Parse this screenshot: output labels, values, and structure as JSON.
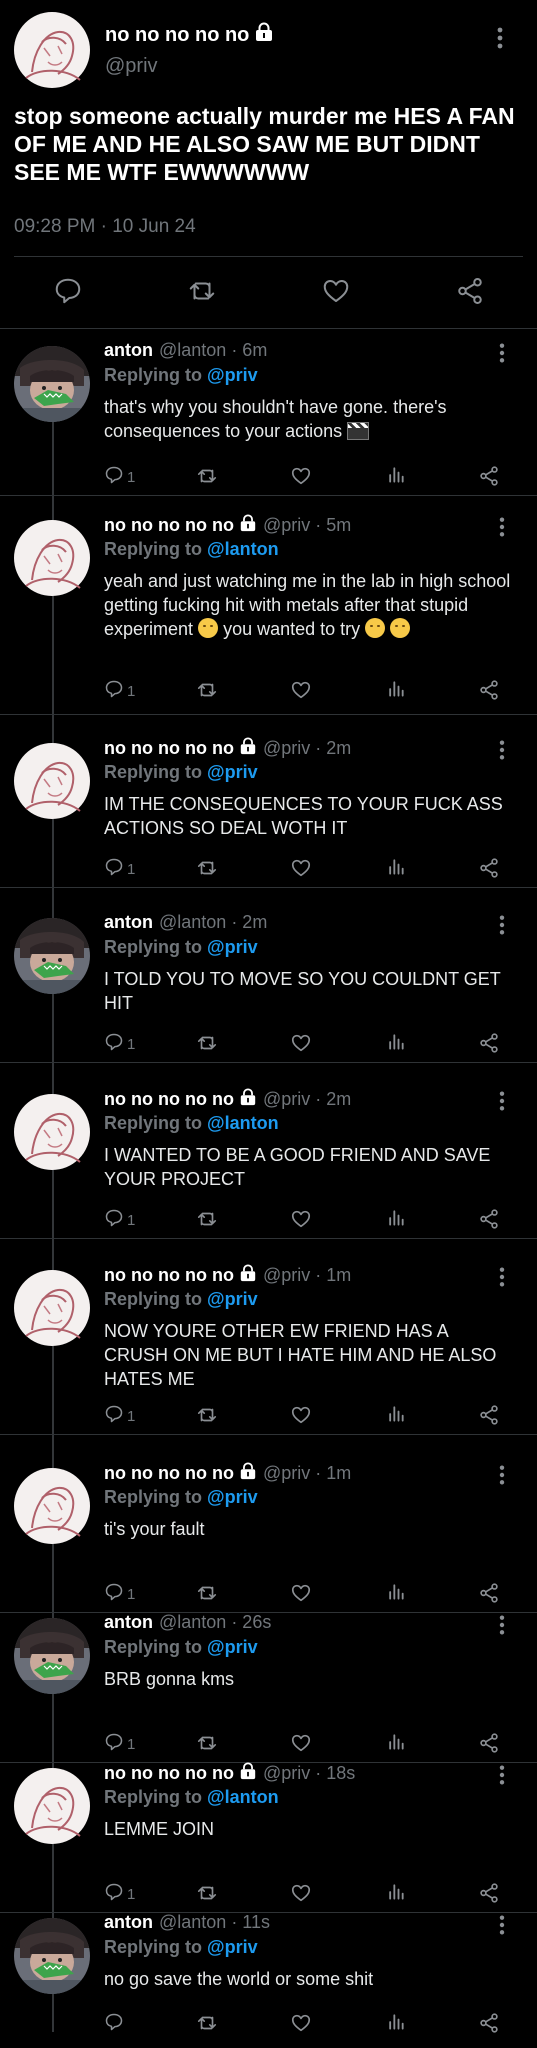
{
  "colors": {
    "background": "#000000",
    "text": "#e7e9ea",
    "muted": "#71767b",
    "link": "#1d9bf0",
    "divider": "#2f3336"
  },
  "main_tweet": {
    "display_name": "no no no no no",
    "handle": "@priv",
    "text": "stop someone actually murder me HES A FAN OF ME AND HE ALSO SAW ME BUT DIDNT SEE ME WTF EWWWWWW",
    "timestamp": "09:28 PM · 10 Jun 24",
    "icons": [
      "lock-icon",
      "more-icon",
      "comment-icon",
      "retweet-icon",
      "like-icon",
      "share-icon"
    ]
  },
  "replies": [
    {
      "avatar": "anton",
      "name": "anton",
      "meta": "@lanton · 6m",
      "replying_label": "Replying to",
      "mention": "@priv",
      "text": "that's why you shouldn't have gone. there's consequences to your actions",
      "comment_count": "1"
    },
    {
      "avatar": "priv",
      "name": "no no no no no",
      "meta": "@priv · 5m",
      "replying_label": "Replying to",
      "mention": "@lanton",
      "text": "yeah and just watching me in the lab in high school getting fucking hit with metals after that stupid experiment",
      "text_after": "you wanted to try",
      "comment_count": "1"
    },
    {
      "avatar": "priv",
      "name": "no no no no no",
      "meta": "@priv · 2m",
      "replying_label": "Replying to",
      "mention": "@priv",
      "text": "IM THE CONSEQUENCES TO YOUR FUCK ASS ACTIONS SO DEAL WOTH IT",
      "comment_count": "1"
    },
    {
      "avatar": "anton",
      "name": "anton",
      "meta": "@lanton · 2m",
      "replying_label": "Replying to",
      "mention": "@priv",
      "text": "I TOLD YOU TO MOVE SO YOU COULDNT GET HIT",
      "comment_count": "1"
    },
    {
      "avatar": "priv",
      "name": "no no no no no",
      "meta": "@priv · 2m",
      "replying_label": "Replying to",
      "mention": "@lanton",
      "text": "I WANTED TO BE A GOOD FRIEND AND SAVE YOUR PROJECT",
      "comment_count": "1"
    },
    {
      "avatar": "priv",
      "name": "no no no no no",
      "meta": "@priv · 1m",
      "replying_label": "Replying to",
      "mention": "@priv",
      "text": "NOW YOURE OTHER EW FRIEND HAS A CRUSH ON ME BUT I HATE HIM AND HE ALSO HATES ME",
      "comment_count": "1"
    },
    {
      "avatar": "priv",
      "name": "no no no no no",
      "meta": "@priv · 1m",
      "replying_label": "Replying to",
      "mention": "@priv",
      "text": "ti's your fault",
      "comment_count": "1"
    },
    {
      "avatar": "anton",
      "name": "anton",
      "meta": "@lanton · 26s",
      "replying_label": "Replying to",
      "mention": "@priv",
      "text": "BRB gonna kms",
      "comment_count": "1"
    },
    {
      "avatar": "priv",
      "name": "no no no no no",
      "meta": "@priv · 18s",
      "replying_label": "Replying to",
      "mention": "@lanton",
      "text": "LEMME JOIN",
      "comment_count": "1"
    },
    {
      "avatar": "anton",
      "name": "anton",
      "meta": "@lanton · 11s",
      "replying_label": "Replying to",
      "mention": "@priv",
      "text": "no go save the world or some shit",
      "comment_count": ""
    }
  ]
}
